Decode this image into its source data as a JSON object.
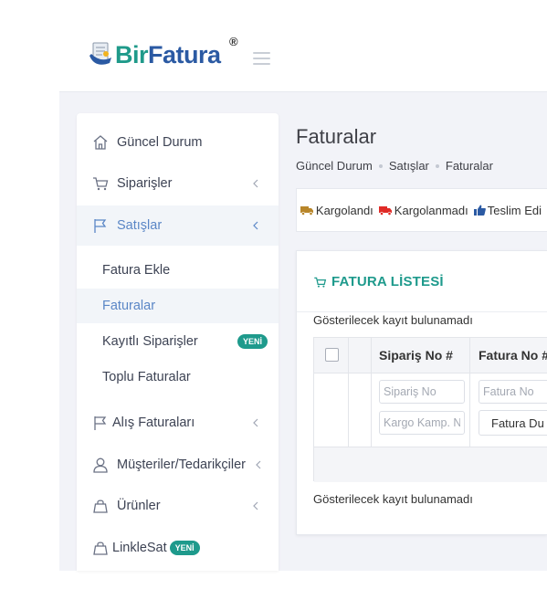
{
  "brand": {
    "name_part1": "Bir",
    "name_part2": "Fatura",
    "registered_mark": "®",
    "colors": {
      "bir": "#1f9a8a",
      "fatura": "#2b5aa3"
    }
  },
  "sidebar": {
    "items": [
      {
        "label": "Güncel Durum",
        "icon": "home-icon"
      },
      {
        "label": "Siparişler",
        "icon": "cart-icon",
        "has_chevron": true
      },
      {
        "label": "Satışlar",
        "icon": "flag-icon",
        "has_chevron": true,
        "active": true
      },
      {
        "label": "Alış Faturaları",
        "icon": "flag-icon",
        "has_chevron": true
      },
      {
        "label": "Müşteriler/Tedarikçiler",
        "icon": "user-icon",
        "has_chevron": true
      },
      {
        "label": "Ürünler",
        "icon": "bag-icon",
        "has_chevron": true
      },
      {
        "label": "LinkleSat",
        "icon": "bag-icon",
        "badge": "YENİ"
      }
    ],
    "sub_items": [
      {
        "label": "Fatura Ekle"
      },
      {
        "label": "Faturalar",
        "active": true
      },
      {
        "label": "Kayıtlı Siparişler",
        "badge": "YENİ"
      },
      {
        "label": "Toplu Faturalar"
      }
    ],
    "badge_color": "#1e9a8c"
  },
  "main": {
    "title": "Faturalar",
    "breadcrumb": [
      "Güncel Durum",
      "Satışlar",
      "Faturalar"
    ],
    "legend": [
      {
        "label": "Kargolandı",
        "icon": "truck-icon",
        "color": "#b8862a"
      },
      {
        "label": "Kargolanmadı",
        "icon": "truck-icon",
        "color": "#e02b27"
      },
      {
        "label": "Teslim Edi",
        "icon": "thumbs-up-icon",
        "color": "#2b5aa3"
      }
    ],
    "panel": {
      "title": "FATURA LİSTESİ",
      "title_icon": "cart-icon",
      "empty_message_top": "Gösterilecek kayıt bulunamadı",
      "empty_message_bottom": "Gösterilecek kayıt bulunamadı",
      "columns": [
        "Sipariş No #",
        "Fatura No #"
      ],
      "filters": {
        "order_no_placeholder": "Sipariş No",
        "campaign_placeholder": "Kargo Kamp. N",
        "invoice_no_placeholder": "Fatura No",
        "invoice_status_selected": "Fatura Du"
      }
    }
  }
}
